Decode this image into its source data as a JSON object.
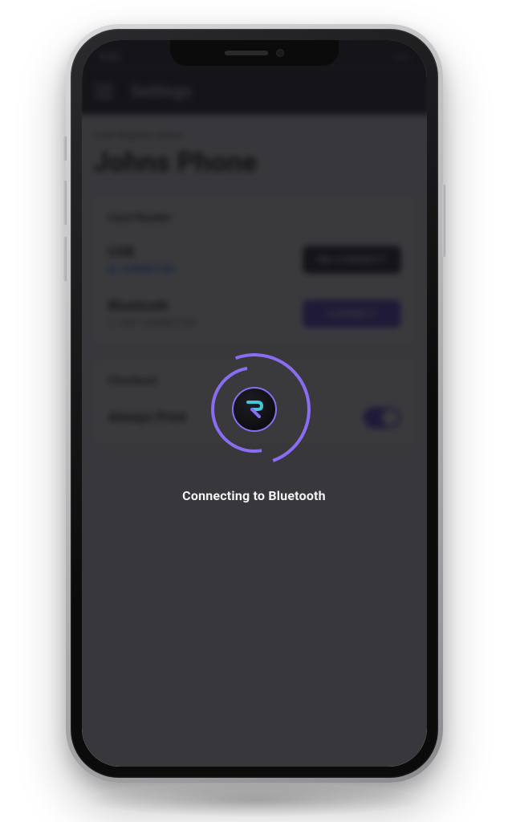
{
  "status_bar": {
    "time": "9:41"
  },
  "header": {
    "title": "Settings"
  },
  "register": {
    "subtitle": "Cash Register Name",
    "name": "Johns Phone"
  },
  "card_reader": {
    "section_title": "Card Reader",
    "usb": {
      "label": "USB",
      "status": "CONNECTED",
      "action": "RE-CONNECT"
    },
    "bluetooth": {
      "label": "Bluetooth",
      "status": "NOT CONNECTED",
      "action": "CONNECT"
    }
  },
  "checkout": {
    "section_title": "Checkout",
    "always_print": "Always Print"
  },
  "overlay": {
    "message": "Connecting to Bluetooth"
  },
  "colors": {
    "accent_purple": "#6b4de0",
    "accent_blue": "#1474ff",
    "header_bg": "#32323a"
  }
}
